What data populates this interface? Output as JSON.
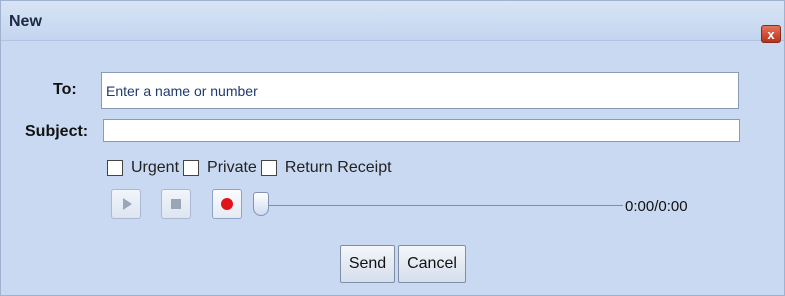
{
  "window": {
    "title": "New",
    "close_symbol": "x"
  },
  "form": {
    "to_label": "To:",
    "to_placeholder": "Enter a name or number",
    "to_value": "",
    "subject_label": "Subject:",
    "subject_value": ""
  },
  "options": [
    {
      "label": "Urgent",
      "checked": false
    },
    {
      "label": "Private",
      "checked": false
    },
    {
      "label": "Return Receipt",
      "checked": false
    }
  ],
  "recorder": {
    "icons": [
      "play-icon",
      "stop-icon",
      "record-icon"
    ],
    "time": "0:00/0:00",
    "progress": 0.0
  },
  "buttons": {
    "send": "Send",
    "cancel": "Cancel"
  },
  "colors": {
    "record": "#e0141b",
    "close": "#c43d25",
    "background": "#c9d9f2"
  }
}
